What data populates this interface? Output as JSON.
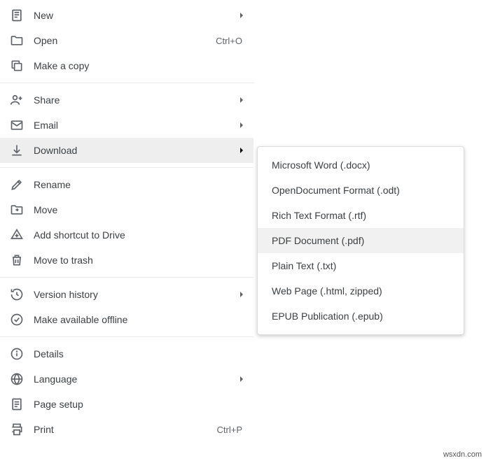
{
  "menu": {
    "new": {
      "label": "New"
    },
    "open": {
      "label": "Open",
      "shortcut": "Ctrl+O"
    },
    "make_copy": {
      "label": "Make a copy"
    },
    "share": {
      "label": "Share"
    },
    "email": {
      "label": "Email"
    },
    "download": {
      "label": "Download"
    },
    "rename": {
      "label": "Rename"
    },
    "move": {
      "label": "Move"
    },
    "add_shortcut": {
      "label": "Add shortcut to Drive"
    },
    "move_to_trash": {
      "label": "Move to trash"
    },
    "version_history": {
      "label": "Version history"
    },
    "make_available_offline": {
      "label": "Make available offline"
    },
    "details": {
      "label": "Details"
    },
    "language": {
      "label": "Language"
    },
    "page_setup": {
      "label": "Page setup"
    },
    "print": {
      "label": "Print",
      "shortcut": "Ctrl+P"
    }
  },
  "submenu": {
    "docx": "Microsoft Word (.docx)",
    "odt": "OpenDocument Format (.odt)",
    "rtf": "Rich Text Format (.rtf)",
    "pdf": "PDF Document (.pdf)",
    "txt": "Plain Text (.txt)",
    "html": "Web Page (.html, zipped)",
    "epub": "EPUB Publication (.epub)"
  },
  "watermark": "wsxdn.com"
}
